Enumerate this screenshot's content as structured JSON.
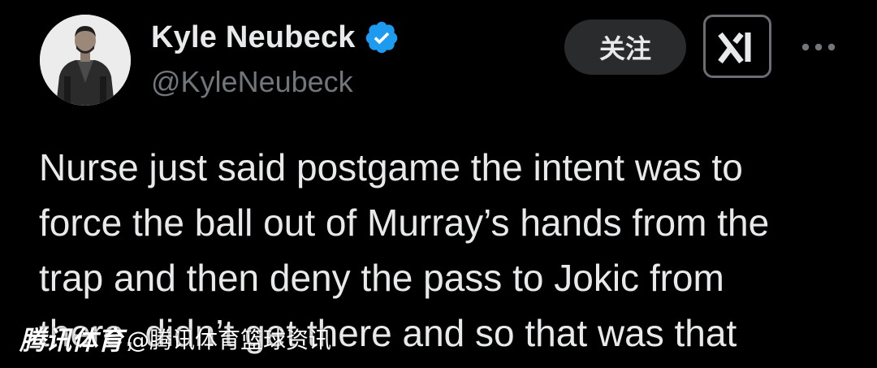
{
  "author": {
    "display_name": "Kyle Neubeck",
    "handle": "@KyleNeubeck",
    "verified": true,
    "verified_color": "#1d9bf0"
  },
  "actions": {
    "follow_label": "关注",
    "grok_icon": "grok-icon",
    "more_icon": "more-icon"
  },
  "tweet": {
    "lines": [
      "Nurse just said postgame the intent was to",
      "force the ball out of Murray’s hands from the",
      "trap and then deny the pass to Jokic from",
      "there, didn’t get there and so that was that"
    ]
  },
  "watermark": {
    "brand": "腾讯体育",
    "account": "@腾讯体育篮球资讯"
  },
  "colors": {
    "background": "#000000",
    "text": "#e7e9ea",
    "secondary_text": "#71767b",
    "follow_button_bg": "#2a2b2d"
  }
}
